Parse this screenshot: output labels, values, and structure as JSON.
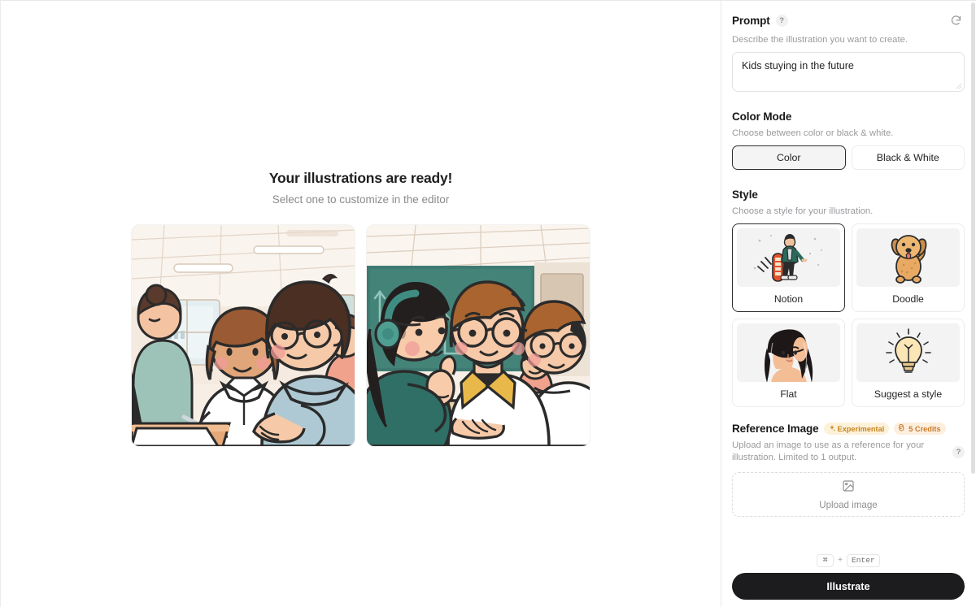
{
  "main": {
    "title": "Your illustrations are ready!",
    "subtitle": "Select one to customize in the editor",
    "results": [
      {
        "alt": "Classroom illustration of three students with a teacher helping a girl write"
      },
      {
        "alt": "Classroom illustration of students at a desk with a girl wearing headphones"
      }
    ]
  },
  "sidebar": {
    "prompt": {
      "title": "Prompt",
      "help_icon": "question-mark-icon",
      "reset_icon": "reset-icon",
      "description": "Describe the illustration you want to create.",
      "value": "Kids stuying in the future",
      "placeholder": "Describe the illustration you want to create."
    },
    "color_mode": {
      "title": "Color Mode",
      "description": "Choose between color or black & white.",
      "options": [
        {
          "label": "Color",
          "selected": true
        },
        {
          "label": "Black & White",
          "selected": false
        }
      ]
    },
    "style": {
      "title": "Style",
      "description": "Choose a style for your illustration.",
      "options": [
        {
          "label": "Notion",
          "selected": true,
          "thumb": "skateboarder-illustration"
        },
        {
          "label": "Doodle",
          "selected": false,
          "thumb": "dog-illustration"
        },
        {
          "label": "Flat",
          "selected": false,
          "thumb": "woman-portrait-illustration"
        },
        {
          "label": "Suggest a style",
          "selected": false,
          "thumb": "lightbulb-illustration"
        }
      ]
    },
    "reference_image": {
      "title": "Reference Image",
      "badges": [
        {
          "label": "Experimental",
          "icon": "sparkle-icon",
          "color": "#c6861f",
          "bg": "#fdf1da"
        },
        {
          "label": "5 Credits",
          "icon": "coins-icon",
          "color": "#c97b2e",
          "bg": "#fdeede"
        }
      ],
      "description": "Upload an image to use as a reference for your illustration. Limited to 1 output.",
      "help_icon": "question-mark-icon",
      "upload_label": "Upload image",
      "upload_icon": "image-placeholder-icon"
    },
    "footer": {
      "shortcut_keys": [
        "⌘",
        "Enter"
      ],
      "shortcut_separator": "+",
      "submit_label": "Illustrate"
    }
  },
  "colors": {
    "accent": "#1c1c1e",
    "selected_border": "#2e2e30",
    "muted_text": "#9b9b9f"
  }
}
